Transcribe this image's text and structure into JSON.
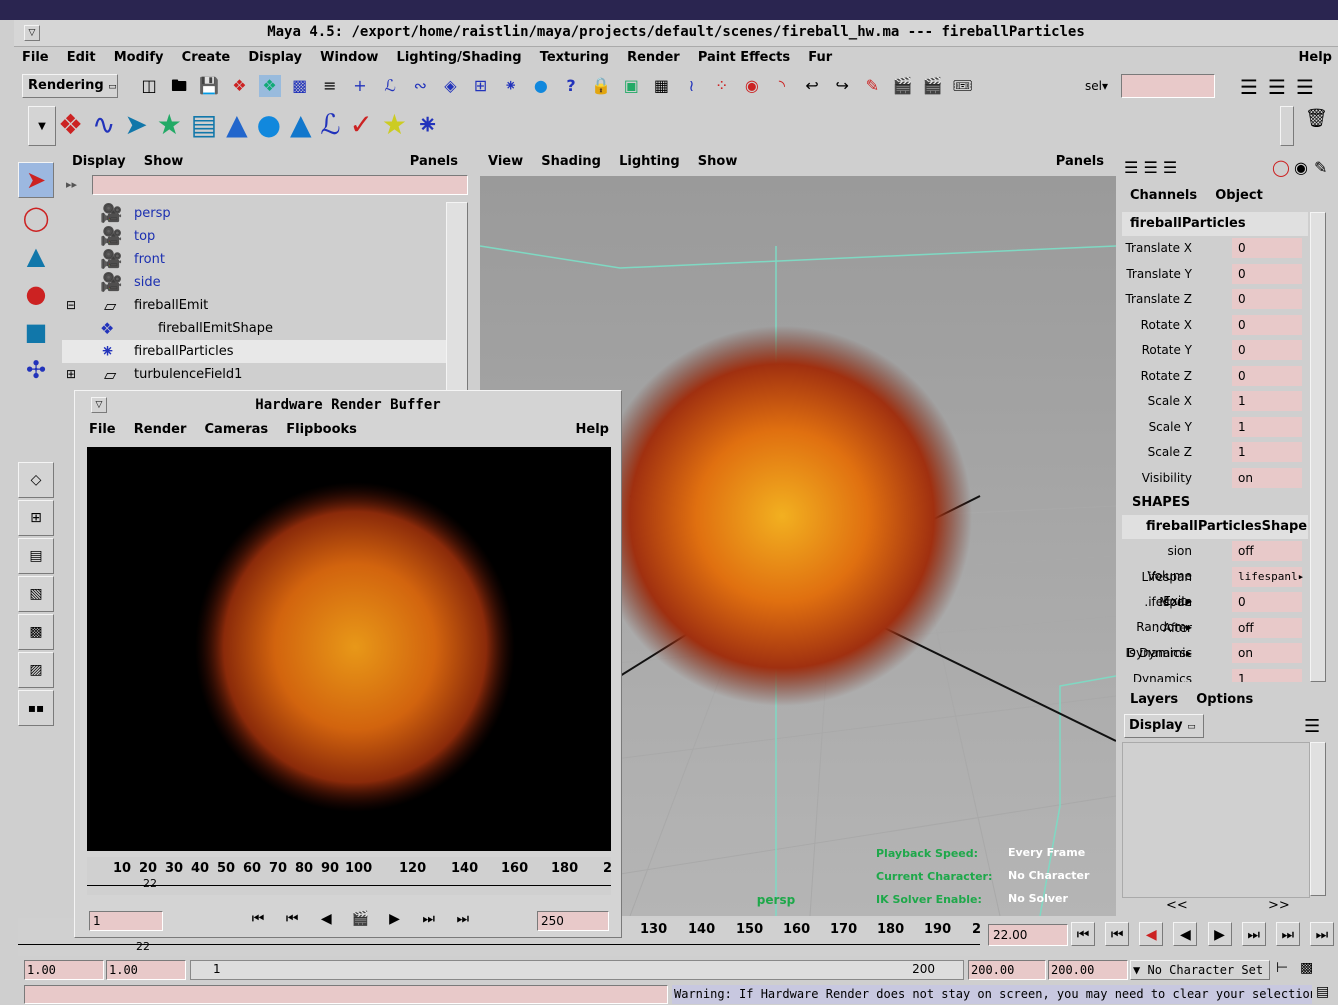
{
  "window": {
    "title": "Maya 4.5: /export/home/raistlin/maya/projects/default/scenes/fireball_hw.ma  ---  fireballParticles"
  },
  "menubar": {
    "items": [
      "File",
      "Edit",
      "Modify",
      "Create",
      "Display",
      "Window",
      "Lighting/Shading",
      "Texturing",
      "Render",
      "Paint Effects",
      "Fur"
    ],
    "help": "Help"
  },
  "statusline": {
    "menuset": "Rendering",
    "sel": "sel▾"
  },
  "outliner": {
    "menu": [
      "Display",
      "Show"
    ],
    "panels": "Panels",
    "items": [
      {
        "label": "persp",
        "kind": "camera"
      },
      {
        "label": "top",
        "kind": "camera"
      },
      {
        "label": "front",
        "kind": "camera"
      },
      {
        "label": "side",
        "kind": "camera"
      },
      {
        "label": "fireballEmit",
        "kind": "emitter"
      },
      {
        "label": "fireballEmitShape",
        "kind": "shape"
      },
      {
        "label": "fireballParticles",
        "kind": "particles"
      },
      {
        "label": "turbulenceField1",
        "kind": "field"
      }
    ]
  },
  "viewport": {
    "menu": [
      "View",
      "Shading",
      "Lighting",
      "Show"
    ],
    "panels": "Panels",
    "camera": "persp",
    "hud": [
      {
        "label": "Playback Speed:",
        "value": "Every Frame"
      },
      {
        "label": "Current Character:",
        "value": "No Character"
      },
      {
        "label": "IK Solver Enable:",
        "value": "No Solver"
      }
    ]
  },
  "channelbox": {
    "tabs": [
      "Channels",
      "Object"
    ],
    "object": "fireballParticles",
    "channels": [
      {
        "name": "Translate X",
        "value": "0"
      },
      {
        "name": "Translate Y",
        "value": "0"
      },
      {
        "name": "Translate Z",
        "value": "0"
      },
      {
        "name": "Rotate X",
        "value": "0"
      },
      {
        "name": "Rotate Y",
        "value": "0"
      },
      {
        "name": "Rotate Z",
        "value": "0"
      },
      {
        "name": "Scale X",
        "value": "1"
      },
      {
        "name": "Scale Y",
        "value": "1"
      },
      {
        "name": "Scale Z",
        "value": "1"
      },
      {
        "name": "Visibility",
        "value": "on"
      }
    ],
    "shapes_header": "SHAPES",
    "shape_name": "fireballParticlesShape",
    "shape_channels": [
      {
        "name": "sion Volume Exit▸",
        "value": "off"
      },
      {
        "name": "Lifespan Mode",
        "value": "lifespanl▸"
      },
      {
        "name": ".ifespan Random▸",
        "value": "0"
      },
      {
        "name": ": After Dynamics▸",
        "value": "off"
      },
      {
        "name": "Is Dynamic",
        "value": "on"
      },
      {
        "name": "Dynamics Weight",
        "value": "1"
      }
    ]
  },
  "layers": {
    "tabs": [
      "Layers",
      "Options"
    ],
    "display": "Display",
    "nav_prev": "<<",
    "nav_next": ">>"
  },
  "render_buffer": {
    "title": "Hardware Render Buffer",
    "menu": [
      "File",
      "Render",
      "Cameras",
      "Flipbooks"
    ],
    "help": "Help",
    "ticks": [
      "10",
      "20",
      "30",
      "40",
      "50",
      "60",
      "70",
      "80",
      "90",
      "100",
      "120",
      "140",
      "160",
      "180",
      "2"
    ],
    "current_frame_marker": "22",
    "start": "1",
    "end": "250"
  },
  "timeline": {
    "ticks": [
      "130",
      "140",
      "150",
      "160",
      "170",
      "180",
      "190",
      "2"
    ],
    "current_time": "22.00",
    "partial_label": "22"
  },
  "range": {
    "start_a": "1.00",
    "start_b": "1.00",
    "slider_start": "1",
    "slider_end": "200",
    "end_a": "200.00",
    "end_b": "200.00",
    "character": "No Character Set"
  },
  "helpline": {
    "warning": "Warning: If Hardware Render does not stay on screen, you may need to clear your selection."
  },
  "colors": {
    "bg": "#cfcfcf",
    "field": "#e8c9c9",
    "viewport": "#9c9c9c",
    "grid": "#7fd9c3",
    "hud_label": "#1ea84a"
  }
}
